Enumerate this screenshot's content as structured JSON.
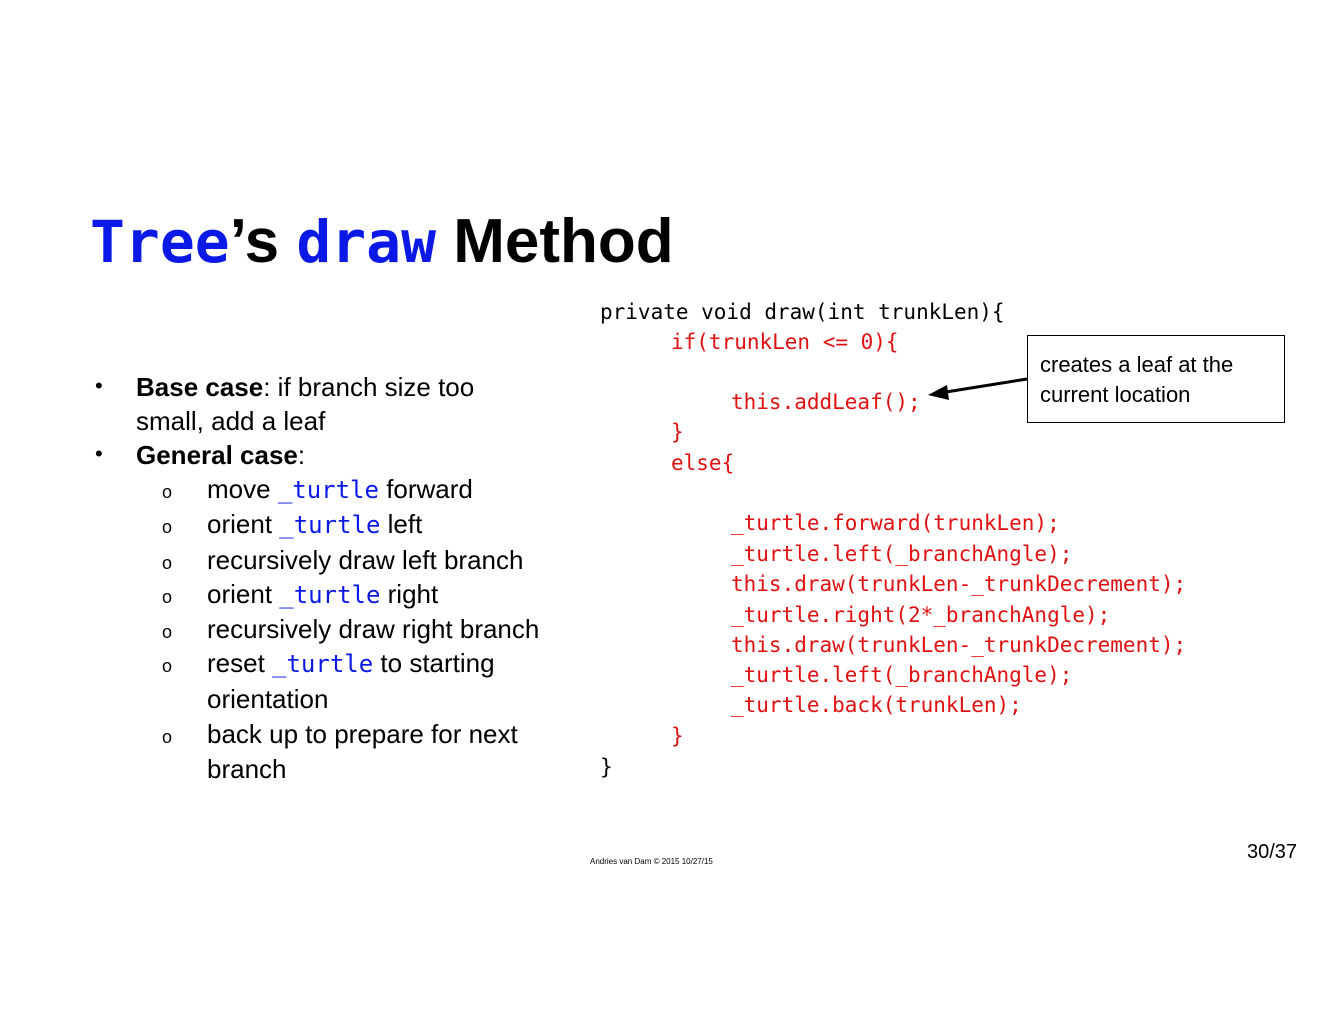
{
  "title": {
    "class_name": "Tree",
    "possessive": "’s",
    "method_name": "draw",
    "suffix": "Method"
  },
  "bullets": {
    "base_case_label": "Base case",
    "base_case_text_1": ": if branch size too",
    "base_case_text_2": "small, add a leaf",
    "general_case_label": "General case",
    "general_case_colon": ":",
    "bullet_glyph": "•",
    "sub_glyph": "o",
    "sub_items": [
      {
        "pre": "move ",
        "code": "_turtle",
        "post": " forward",
        "cont": ""
      },
      {
        "pre": "orient ",
        "code": "_turtle",
        "post": "  left",
        "cont": ""
      },
      {
        "pre": "recursively draw left branch",
        "code": "",
        "post": "",
        "cont": ""
      },
      {
        "pre": "orient ",
        "code": "_turtle",
        "post": "  right",
        "cont": ""
      },
      {
        "pre": "recursively draw right branch",
        "code": "",
        "post": "",
        "cont": ""
      },
      {
        "pre": "reset ",
        "code": "_turtle",
        "post": " to starting",
        "cont": "orientation"
      },
      {
        "pre": "back up to prepare for next",
        "code": "",
        "post": "",
        "cont": "branch"
      }
    ]
  },
  "code": {
    "lines": [
      "private void draw(int trunkLen){",
      "if(trunkLen <= 0){",
      "this.addLeaf();",
      "}",
      "else{",
      "_turtle.forward(trunkLen);",
      "_turtle.left(_branchAngle);",
      "this.draw(trunkLen-_trunkDecrement);",
      "_turtle.right(2*_branchAngle);",
      "this.draw(trunkLen-_trunkDecrement);",
      "_turtle.left(_branchAngle);",
      "_turtle.back(trunkLen);",
      "}",
      "}"
    ]
  },
  "callout": {
    "line_1": "creates a leaf at the",
    "line_2": "current location"
  },
  "footer": {
    "credit": "Andries van Dam © 2015 10/27/15",
    "page": "30/37"
  },
  "colors": {
    "code_blue": "#0a19e6",
    "code_red": "#e01010",
    "text": "#000000"
  }
}
